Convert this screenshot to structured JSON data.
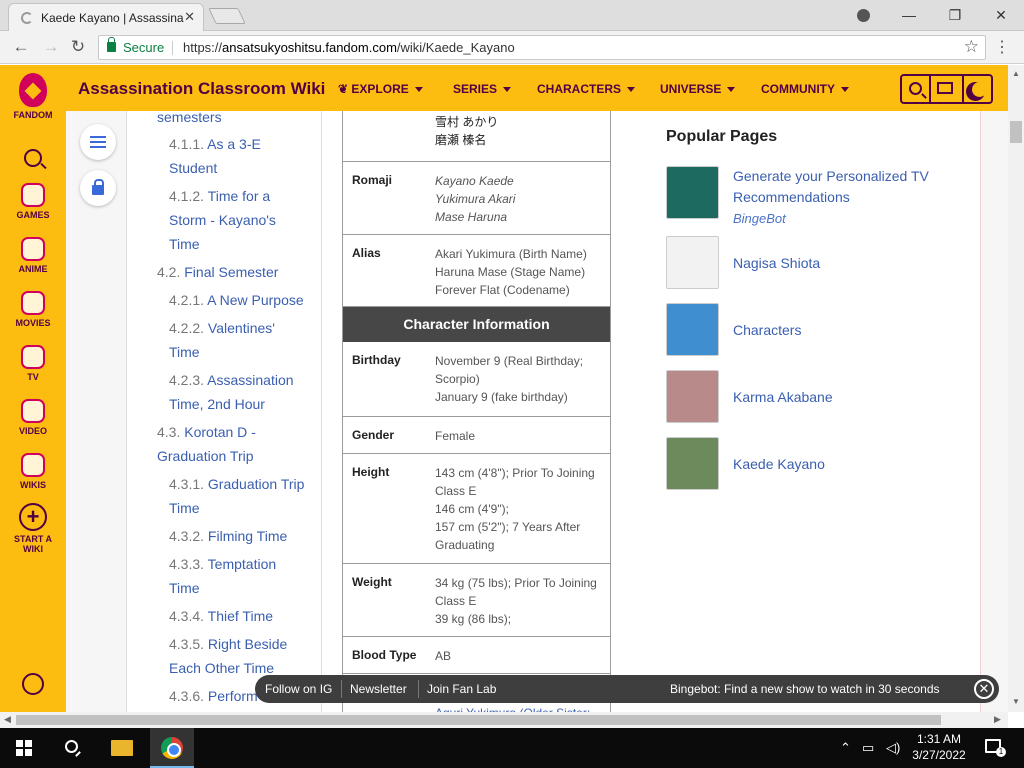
{
  "browser": {
    "tab_title": "Kaede Kayano | Assassina",
    "secure_label": "Secure",
    "url_scheme": "https://",
    "url_domain": "ansatsukyoshitsu.fandom.com",
    "url_path": "/wiki/Kaede_Kayano"
  },
  "rail": {
    "fandom": "FANDOM",
    "games": "GAMES",
    "anime": "ANIME",
    "movies": "MOVIES",
    "tv": "TV",
    "video": "VIDEO",
    "wikis": "WIKIS",
    "start_line1": "START A",
    "start_line2": "WIKI"
  },
  "header": {
    "wiki_title": "Assassination Classroom Wiki",
    "nav": [
      "EXPLORE",
      "SERIES",
      "CHARACTERS",
      "UNIVERSE",
      "COMMUNITY"
    ]
  },
  "toc": [
    {
      "num": "",
      "text": "semesters"
    },
    {
      "num": "4.1.1.",
      "text": "As a 3-E"
    },
    {
      "num": "",
      "text": "Student"
    },
    {
      "num": "4.1.2.",
      "text": "Time for a"
    },
    {
      "num": "",
      "text": "Storm - Kayano's"
    },
    {
      "num": "",
      "text": "Time"
    },
    {
      "num": "4.2.",
      "text": "Final Semester"
    },
    {
      "num": "4.2.1.",
      "text": "A New Purpose"
    },
    {
      "num": "4.2.2.",
      "text": "Valentines'"
    },
    {
      "num": "",
      "text": "Time"
    },
    {
      "num": "4.2.3.",
      "text": "Assassination"
    },
    {
      "num": "",
      "text": "Time, 2nd Hour"
    },
    {
      "num": "4.3.",
      "text": "Korotan D -"
    },
    {
      "num": "",
      "text": "Graduation Trip"
    },
    {
      "num": "4.3.1.",
      "text": "Graduation Trip"
    },
    {
      "num": "",
      "text": "Time"
    },
    {
      "num": "4.3.2.",
      "text": "Filming Time"
    },
    {
      "num": "4.3.3.",
      "text": "Temptation"
    },
    {
      "num": "",
      "text": "Time"
    },
    {
      "num": "4.3.4.",
      "text": "Thief Time"
    },
    {
      "num": "4.3.5.",
      "text": "Right Beside"
    },
    {
      "num": "",
      "text": "Each Other Time"
    },
    {
      "num": "4.3.6.",
      "text": "Perform"
    }
  ],
  "infobox": {
    "kanji_lines": [
      "雪村 あかり",
      "磨瀬 榛名"
    ],
    "romaji_label": "Romaji",
    "romaji": [
      "Kayano Kaede",
      "Yukimura Akari",
      "Mase Haruna"
    ],
    "alias_label": "Alias",
    "alias": [
      "Akari Yukimura (Birth Name)",
      "Haruna Mase (Stage Name)",
      "Forever Flat (Codename)"
    ],
    "section_title": "Character Information",
    "birthday_label": "Birthday",
    "birthday": [
      "November 9 (Real Birthday;",
      "Scorpio)",
      "January 9 (fake birthday)"
    ],
    "gender_label": "Gender",
    "gender": "Female",
    "height_label": "Height",
    "height": [
      "143 cm (4'8\"); Prior To Joining",
      "Class E",
      "146 cm (4'9\");",
      "157 cm (5'2\"); 7 Years After",
      "Graduating"
    ],
    "weight_label": "Weight",
    "weight": [
      "34 kg (75 lbs); Prior To Joining",
      "Class E",
      "39 kg (86 lbs);"
    ],
    "blood_label": "Blood Type",
    "blood": "AB",
    "partial_next": "Aguri Yukimura (Older Sister;"
  },
  "popular": {
    "title": "Popular Pages",
    "items": [
      {
        "label": "Generate your Personalized TV Recommendations",
        "sub": "BingeBot"
      },
      {
        "label": "Nagisa Shiota",
        "sub": ""
      },
      {
        "label": "Characters",
        "sub": ""
      },
      {
        "label": "Karma Akabane",
        "sub": ""
      },
      {
        "label": "Kaede Kayano",
        "sub": ""
      }
    ]
  },
  "bottom_bar": {
    "ig": "Follow on IG",
    "newsletter": "Newsletter",
    "fanlab": "Join Fan Lab",
    "bingebot": "Bingebot: Find a new show to watch in 30 seconds"
  },
  "taskbar": {
    "time": "1:31 AM",
    "date": "3/27/2022",
    "notif_count": "1"
  },
  "colors": {
    "fandom_yellow": "#fcbd10",
    "fandom_purple": "#520044",
    "fandom_pink": "#d1005a",
    "link_blue": "#3a5fb0"
  }
}
